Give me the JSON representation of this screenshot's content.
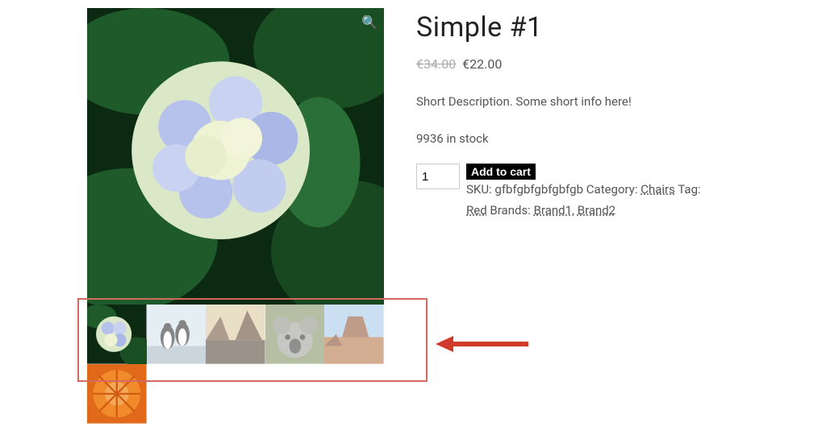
{
  "product": {
    "title": "Simple #1",
    "currency": "€",
    "old_price": "34.00",
    "price": "22.00",
    "short_description": "Short Description. Some short info here!",
    "stock_text": "9936 in stock",
    "quantity_value": "1",
    "add_to_cart_label": "Add to cart",
    "meta": {
      "sku_label": "SKU:",
      "sku_value": "gfbfgbfgbfgbfgb",
      "category_label": "Category:",
      "category_value": "Chairs",
      "tag_label": "Tag:",
      "tag_value": "Red",
      "brands_label": "Brands:",
      "brand1": "Brand1",
      "brand2": "Brand2",
      "separator": ", "
    }
  },
  "gallery": {
    "main_image": "hydrangea",
    "zoom_icon": "🔍",
    "thumbnails": [
      {
        "name": "hydrangea",
        "faded": false
      },
      {
        "name": "penguins",
        "faded": true
      },
      {
        "name": "sunset-cliff",
        "faded": true
      },
      {
        "name": "koala",
        "faded": true
      },
      {
        "name": "desert-mesa",
        "faded": true
      }
    ]
  }
}
